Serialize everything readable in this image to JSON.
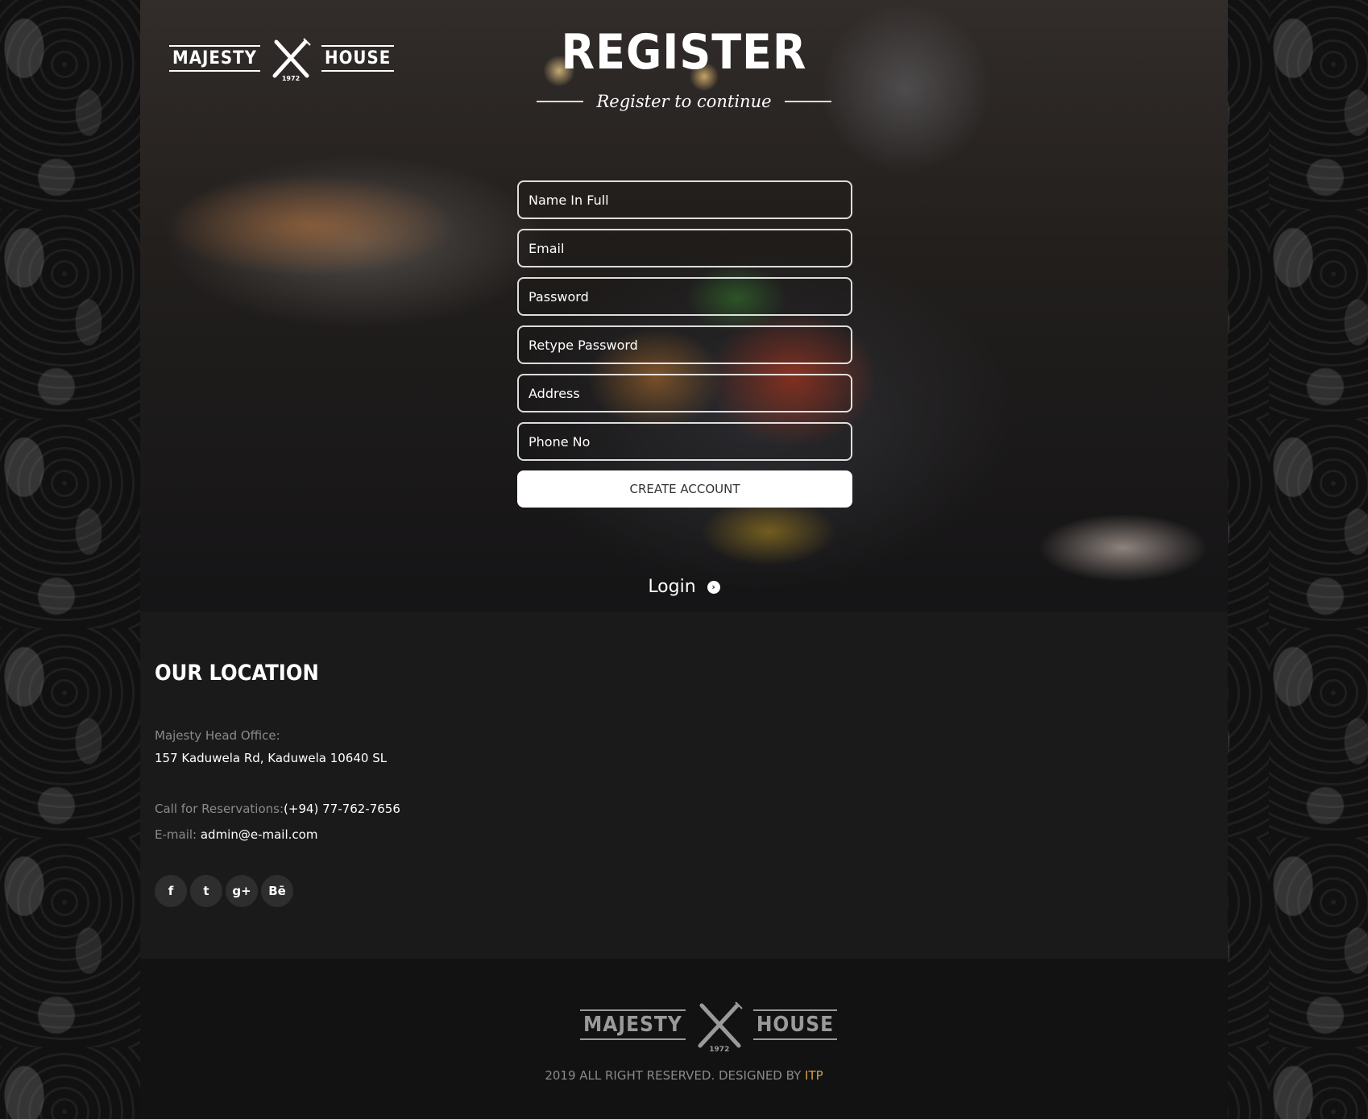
{
  "brand": {
    "logo_left": "MAJESTY",
    "logo_right": "HOUSE",
    "logo_year": "1972"
  },
  "register": {
    "title": "REGISTER",
    "subtitle": "Register to continue",
    "fields": {
      "name_placeholder": "Name In Full",
      "email_placeholder": "Email",
      "password_placeholder": "Password",
      "retype_placeholder": "Retype Password",
      "address_placeholder": "Address",
      "phone_placeholder": "Phone No"
    },
    "create_button": "CREATE ACCOUNT",
    "login_link": "Login"
  },
  "location": {
    "heading": "OUR LOCATION",
    "office_label": "Majesty Head Office:",
    "office_address": "157 Kaduwela Rd, Kaduwela 10640 SL",
    "phone_label": "Call for Reservations:",
    "phone_value": "(+94) 77-762-7656",
    "email_label": "E-mail: ",
    "email_value": "admin@e-mail.com",
    "socials": [
      {
        "icon": "facebook-icon",
        "glyph": "f"
      },
      {
        "icon": "twitter-icon",
        "glyph": "t"
      },
      {
        "icon": "google-plus-icon",
        "glyph": "g+"
      },
      {
        "icon": "behance-icon",
        "glyph": "Bē"
      }
    ]
  },
  "footer": {
    "copyright_prefix": "2019 ALL RIGHT RESERVED. DESIGNED BY ",
    "designer": "ITP"
  },
  "colors": {
    "accent_link": "#d4a04a",
    "panel_background": "#1a1a1a",
    "footer_background": "#121212"
  }
}
